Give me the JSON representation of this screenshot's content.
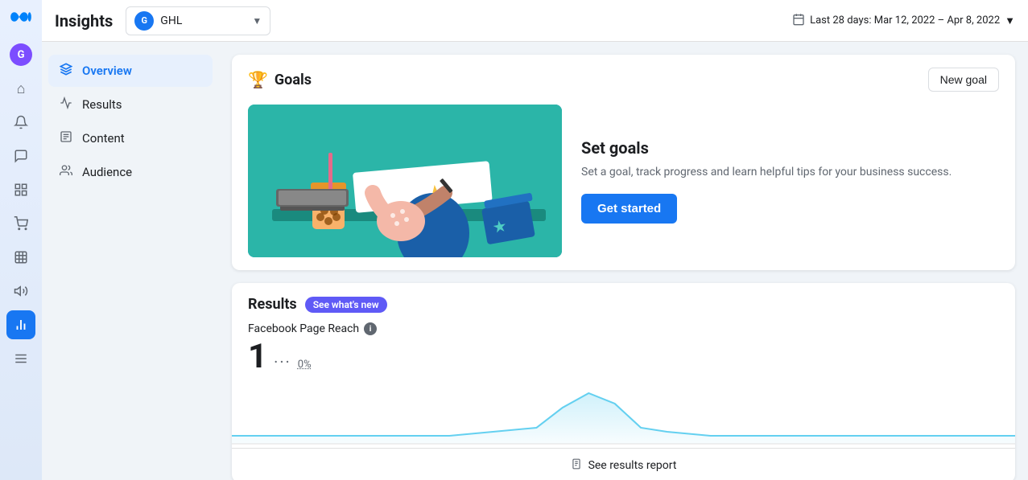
{
  "header": {
    "title": "Insights",
    "account": {
      "name": "GHL",
      "initial": "G"
    },
    "date_range": "Last 28 days: Mar 12, 2022 – Apr 8, 2022",
    "user_initial": "G"
  },
  "nav": {
    "items": [
      {
        "label": "Overview",
        "active": true,
        "icon": "✦"
      },
      {
        "label": "Results",
        "active": false,
        "icon": "📈"
      },
      {
        "label": "Content",
        "active": false,
        "icon": "📋"
      },
      {
        "label": "Audience",
        "active": false,
        "icon": "👥"
      }
    ]
  },
  "goals_card": {
    "title": "Goals",
    "new_goal_label": "New goal",
    "set_goals_title": "Set goals",
    "set_goals_desc": "Set a goal, track progress and learn helpful tips for your business success.",
    "get_started_label": "Get started"
  },
  "results_card": {
    "title": "Results",
    "badge": "See what's new",
    "metric_label": "Facebook Page Reach",
    "metric_value": "1",
    "metric_dots": "···",
    "metric_percent": "0%",
    "see_results_label": "See results report"
  },
  "sidebar_icons": [
    {
      "name": "home-icon",
      "symbol": "⌂"
    },
    {
      "name": "bell-icon",
      "symbol": "🔔"
    },
    {
      "name": "chat-icon",
      "symbol": "💬"
    },
    {
      "name": "pages-icon",
      "symbol": "🗂"
    },
    {
      "name": "cart-icon",
      "symbol": "🛒"
    },
    {
      "name": "table-icon",
      "symbol": "⊞"
    },
    {
      "name": "megaphone-icon",
      "symbol": "📣"
    },
    {
      "name": "chart-icon",
      "symbol": "📊"
    },
    {
      "name": "menu-icon",
      "symbol": "≡"
    }
  ],
  "colors": {
    "active_blue": "#1877f2",
    "badge_purple": "#5f5af6",
    "chart_line": "#64d0f0",
    "chart_fill": "rgba(100,208,240,0.15)"
  }
}
